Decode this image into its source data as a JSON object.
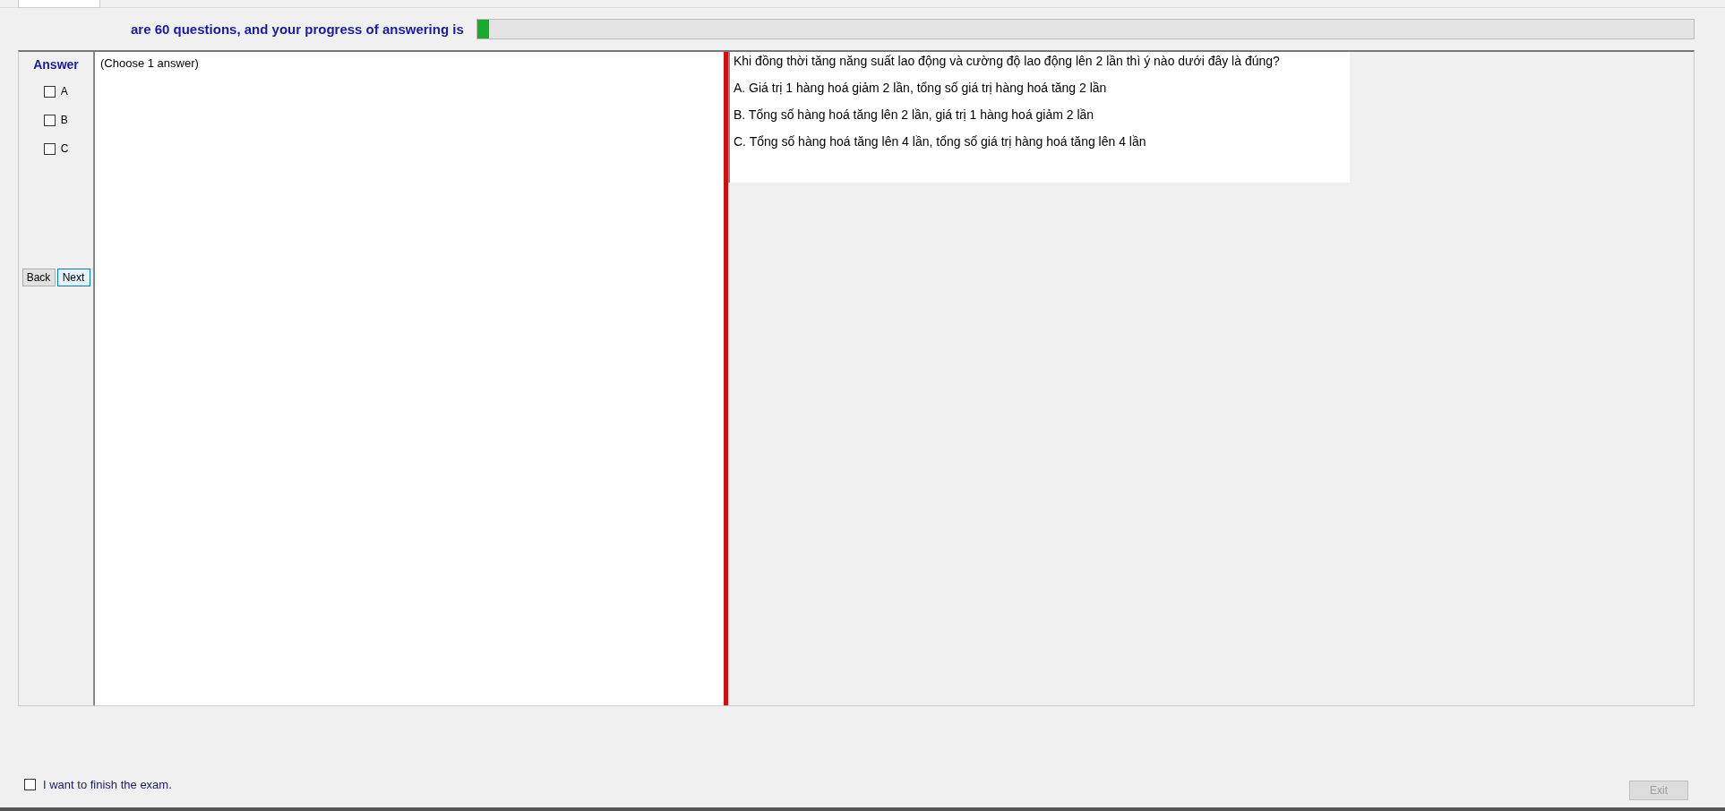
{
  "header": {
    "text": "are 60 questions, and your progress of answering is",
    "progress": {
      "level": 0.01
    }
  },
  "answer_panel": {
    "title": "Answer",
    "options": [
      {
        "label": "A",
        "checked": false
      },
      {
        "label": "B",
        "checked": false
      },
      {
        "label": "C",
        "checked": false
      }
    ],
    "buttons": [
      {
        "label": "Back",
        "selected": false
      },
      {
        "label": "Next",
        "selected": true
      }
    ]
  },
  "instruction": "(Choose 1 answer)",
  "question": {
    "text": "Khi đồng thời tăng năng suất lao động và cường độ lao động lên 2 lần thì ý nào dưới đây là đúng?",
    "choices": [
      "A.  Giá trị 1 hàng hoá giảm 2 lần, tổng số giá trị hàng hoá tăng 2 lần",
      "B.  Tổng số hàng hoá tăng lên 2 lần, giá trị 1 hàng hoá giảm 2 lần",
      "C.  Tổng số hàng hoá tăng lên 4 lần, tổng số giá trị hàng hoá tăng lên 4 lần"
    ]
  },
  "footer": {
    "finish": {
      "label": "I want to finish the exam.",
      "checked": false
    },
    "exit_button": {
      "label": "Exit",
      "disabled": true
    }
  }
}
